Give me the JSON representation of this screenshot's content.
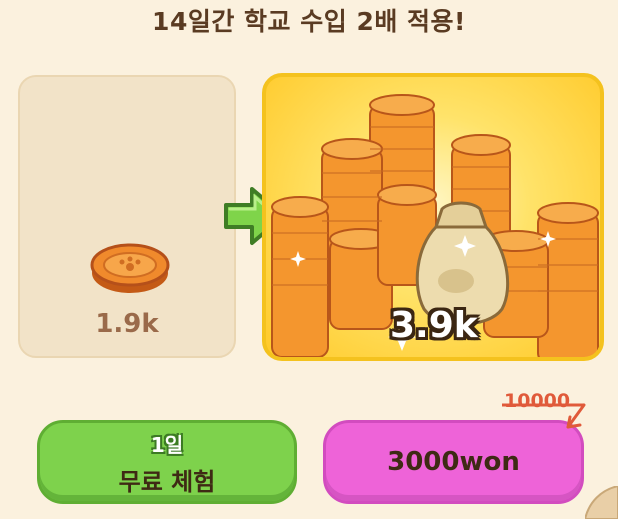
{
  "title": "14일간 학교 수입 2배 적용!",
  "compare": {
    "before_amount": "1.9k",
    "after_amount": "3.9k"
  },
  "buttons": {
    "trial_days": "1일",
    "trial_label": "무료 체험",
    "buy_label": "3000won"
  },
  "price": {
    "original": "10000"
  },
  "colors": {
    "accent_green": "#7ed24c",
    "accent_pink": "#ee63d8",
    "gold": "#ffc928"
  },
  "icons": [
    "coin-icon",
    "arrow-right-icon",
    "coin-pile-icon",
    "money-bag-icon"
  ]
}
